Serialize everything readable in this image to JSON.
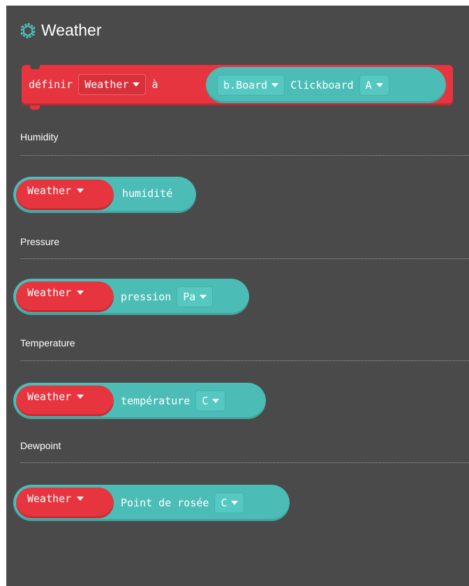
{
  "category": {
    "title": "Weather",
    "icon": "weather-gear-icon",
    "color": "#4bbdb6"
  },
  "colors": {
    "background": "#4a4a4a",
    "variable_block": "#e6353f",
    "extension_block": "#4bbdb6"
  },
  "set_block": {
    "keyword": "définir",
    "variable": "Weather",
    "to_label": "à",
    "board": "b.Board",
    "clickboard_label": "Clickboard",
    "slot": "A"
  },
  "sections": [
    {
      "label": "Humidity",
      "block": {
        "variable": "Weather",
        "reading": "humidité"
      }
    },
    {
      "label": "Pressure",
      "block": {
        "variable": "Weather",
        "reading": "pression",
        "unit": "Pa"
      }
    },
    {
      "label": "Temperature",
      "block": {
        "variable": "Weather",
        "reading": "température",
        "unit": "C"
      }
    },
    {
      "label": "Dewpoint",
      "block": {
        "variable": "Weather",
        "reading": "Point de rosée",
        "unit": "C"
      }
    }
  ]
}
